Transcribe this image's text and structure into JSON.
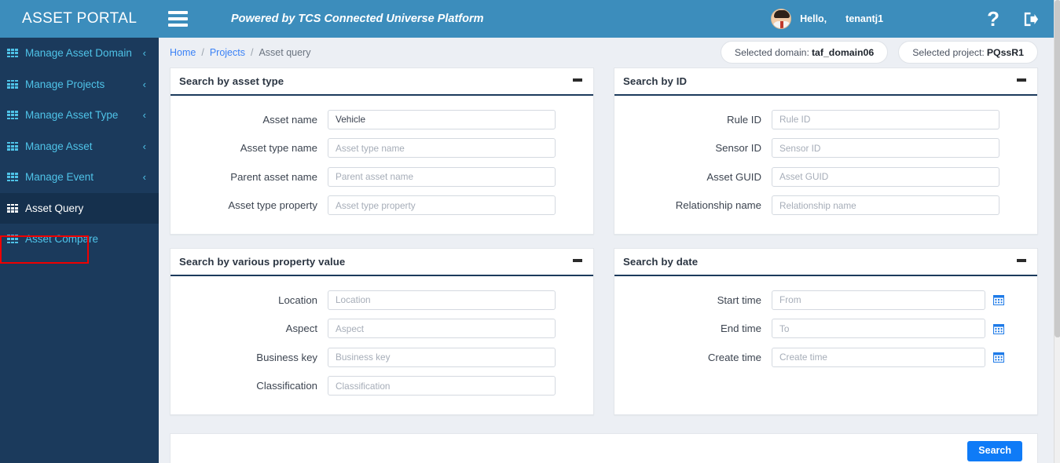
{
  "header": {
    "brand": "ASSET PORTAL",
    "menu_icon": "hamburger-icon",
    "powered_by": "Powered by TCS Connected Universe Platform",
    "greeting": "Hello,",
    "user_name": "tenantj1",
    "help_icon": "?",
    "logout_icon": "logout-icon"
  },
  "sidebar": {
    "items": [
      {
        "label": "Manage Asset Domain",
        "expandable": true,
        "active": false
      },
      {
        "label": "Manage Projects",
        "expandable": true,
        "active": false
      },
      {
        "label": "Manage Asset Type",
        "expandable": true,
        "active": false
      },
      {
        "label": "Manage Asset",
        "expandable": true,
        "active": false
      },
      {
        "label": "Manage Event",
        "expandable": true,
        "active": false
      },
      {
        "label": "Asset Query",
        "expandable": false,
        "active": true
      },
      {
        "label": "Asset Compare",
        "expandable": false,
        "active": false
      }
    ],
    "chevron": "‹"
  },
  "breadcrumb": {
    "home": "Home",
    "projects": "Projects",
    "current": "Asset query",
    "separator": "/"
  },
  "context": {
    "domain_label": "Selected domain:",
    "domain_value": "taf_domain06",
    "project_label": "Selected project:",
    "project_value": "PQssR1"
  },
  "panels": [
    {
      "title": "Search by asset type",
      "fields": [
        {
          "label": "Asset name",
          "placeholder": "Asset name",
          "value": "Vehicle",
          "calendar": false
        },
        {
          "label": "Asset type name",
          "placeholder": "Asset type name",
          "value": "",
          "calendar": false
        },
        {
          "label": "Parent asset name",
          "placeholder": "Parent asset name",
          "value": "",
          "calendar": false
        },
        {
          "label": "Asset type property",
          "placeholder": "Asset type property",
          "value": "",
          "calendar": false
        }
      ]
    },
    {
      "title": "Search by ID",
      "fields": [
        {
          "label": "Rule ID",
          "placeholder": "Rule ID",
          "value": "",
          "calendar": false
        },
        {
          "label": "Sensor ID",
          "placeholder": "Sensor ID",
          "value": "",
          "calendar": false
        },
        {
          "label": "Asset GUID",
          "placeholder": "Asset GUID",
          "value": "",
          "calendar": false
        },
        {
          "label": "Relationship name",
          "placeholder": "Relationship name",
          "value": "",
          "calendar": false
        }
      ]
    },
    {
      "title": "Search by various property value",
      "fields": [
        {
          "label": "Location",
          "placeholder": "Location",
          "value": "",
          "calendar": false
        },
        {
          "label": "Aspect",
          "placeholder": "Aspect",
          "value": "",
          "calendar": false
        },
        {
          "label": "Business key",
          "placeholder": "Business key",
          "value": "",
          "calendar": false
        },
        {
          "label": "Classification",
          "placeholder": "Classification",
          "value": "",
          "calendar": false
        }
      ]
    },
    {
      "title": "Search by date",
      "fields": [
        {
          "label": "Start time",
          "placeholder": "From",
          "value": "",
          "calendar": true
        },
        {
          "label": "End time",
          "placeholder": "To",
          "value": "",
          "calendar": true
        },
        {
          "label": "Create time",
          "placeholder": "Create time",
          "value": "",
          "calendar": true
        }
      ]
    }
  ],
  "actions": {
    "search_label": "Search"
  },
  "colors": {
    "header_blue": "#3c8dbc",
    "sidebar_navy": "#1b3a5c",
    "sidebar_active": "#15304d",
    "nav_text": "#4fc3e8",
    "highlight_red": "#ef0000",
    "accent_blue": "#0f7bf7",
    "page_bg": "#eceff4",
    "panel_rule": "#1b3a5c"
  }
}
